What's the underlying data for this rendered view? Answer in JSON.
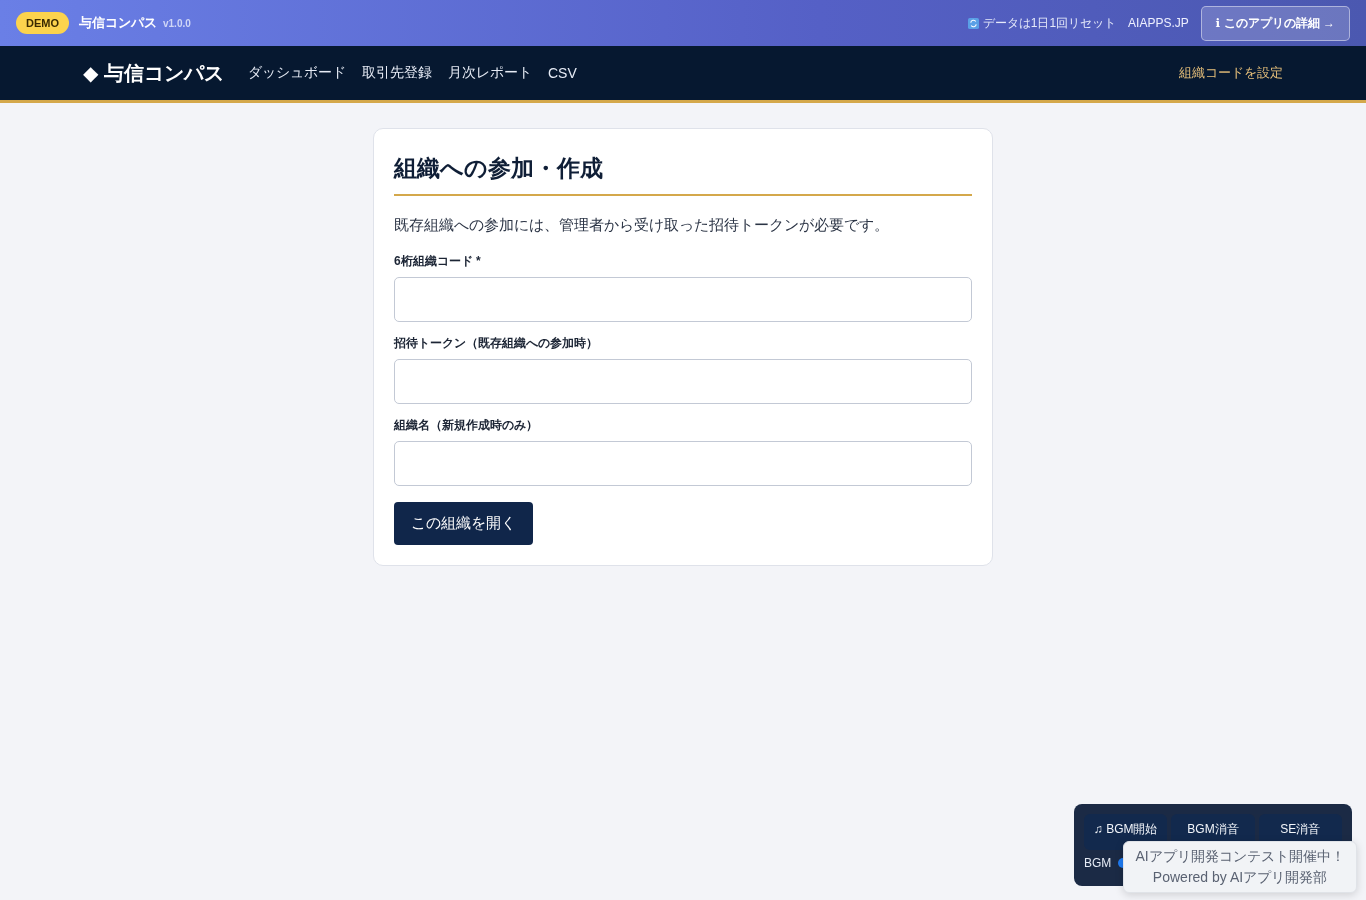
{
  "topbar": {
    "badge": "DEMO",
    "app_name": "与信コンパス",
    "version": "v1.0.0",
    "reset_note": "データは1日1回リセット",
    "site_link": "AIAPPS.JP",
    "details_button": "ℹ このアプリの詳細 →"
  },
  "navbar": {
    "logo": "◆ 与信コンパス",
    "items": [
      "ダッシュボード",
      "取引先登録",
      "月次レポート",
      "CSV"
    ],
    "org_link": "組織コードを設定"
  },
  "card": {
    "title": "組織への参加・作成",
    "description": "既存組織への参加には、管理者から受け取った招待トークンが必要です。",
    "fields": [
      {
        "label": "6桁組織コード *"
      },
      {
        "label": "招待トークン（既存組織への参加時）"
      },
      {
        "label": "組織名（新規作成時のみ）"
      }
    ],
    "submit_button": "この組織を開く"
  },
  "sound_panel": {
    "buttons": [
      "♫ BGM開始",
      "BGM消音",
      "SE消音"
    ],
    "volume_label": "BGM"
  },
  "toast": {
    "lines": [
      "AIアプリ開発コンテスト開催中！",
      "Powered by AIアプリ開発部"
    ]
  }
}
